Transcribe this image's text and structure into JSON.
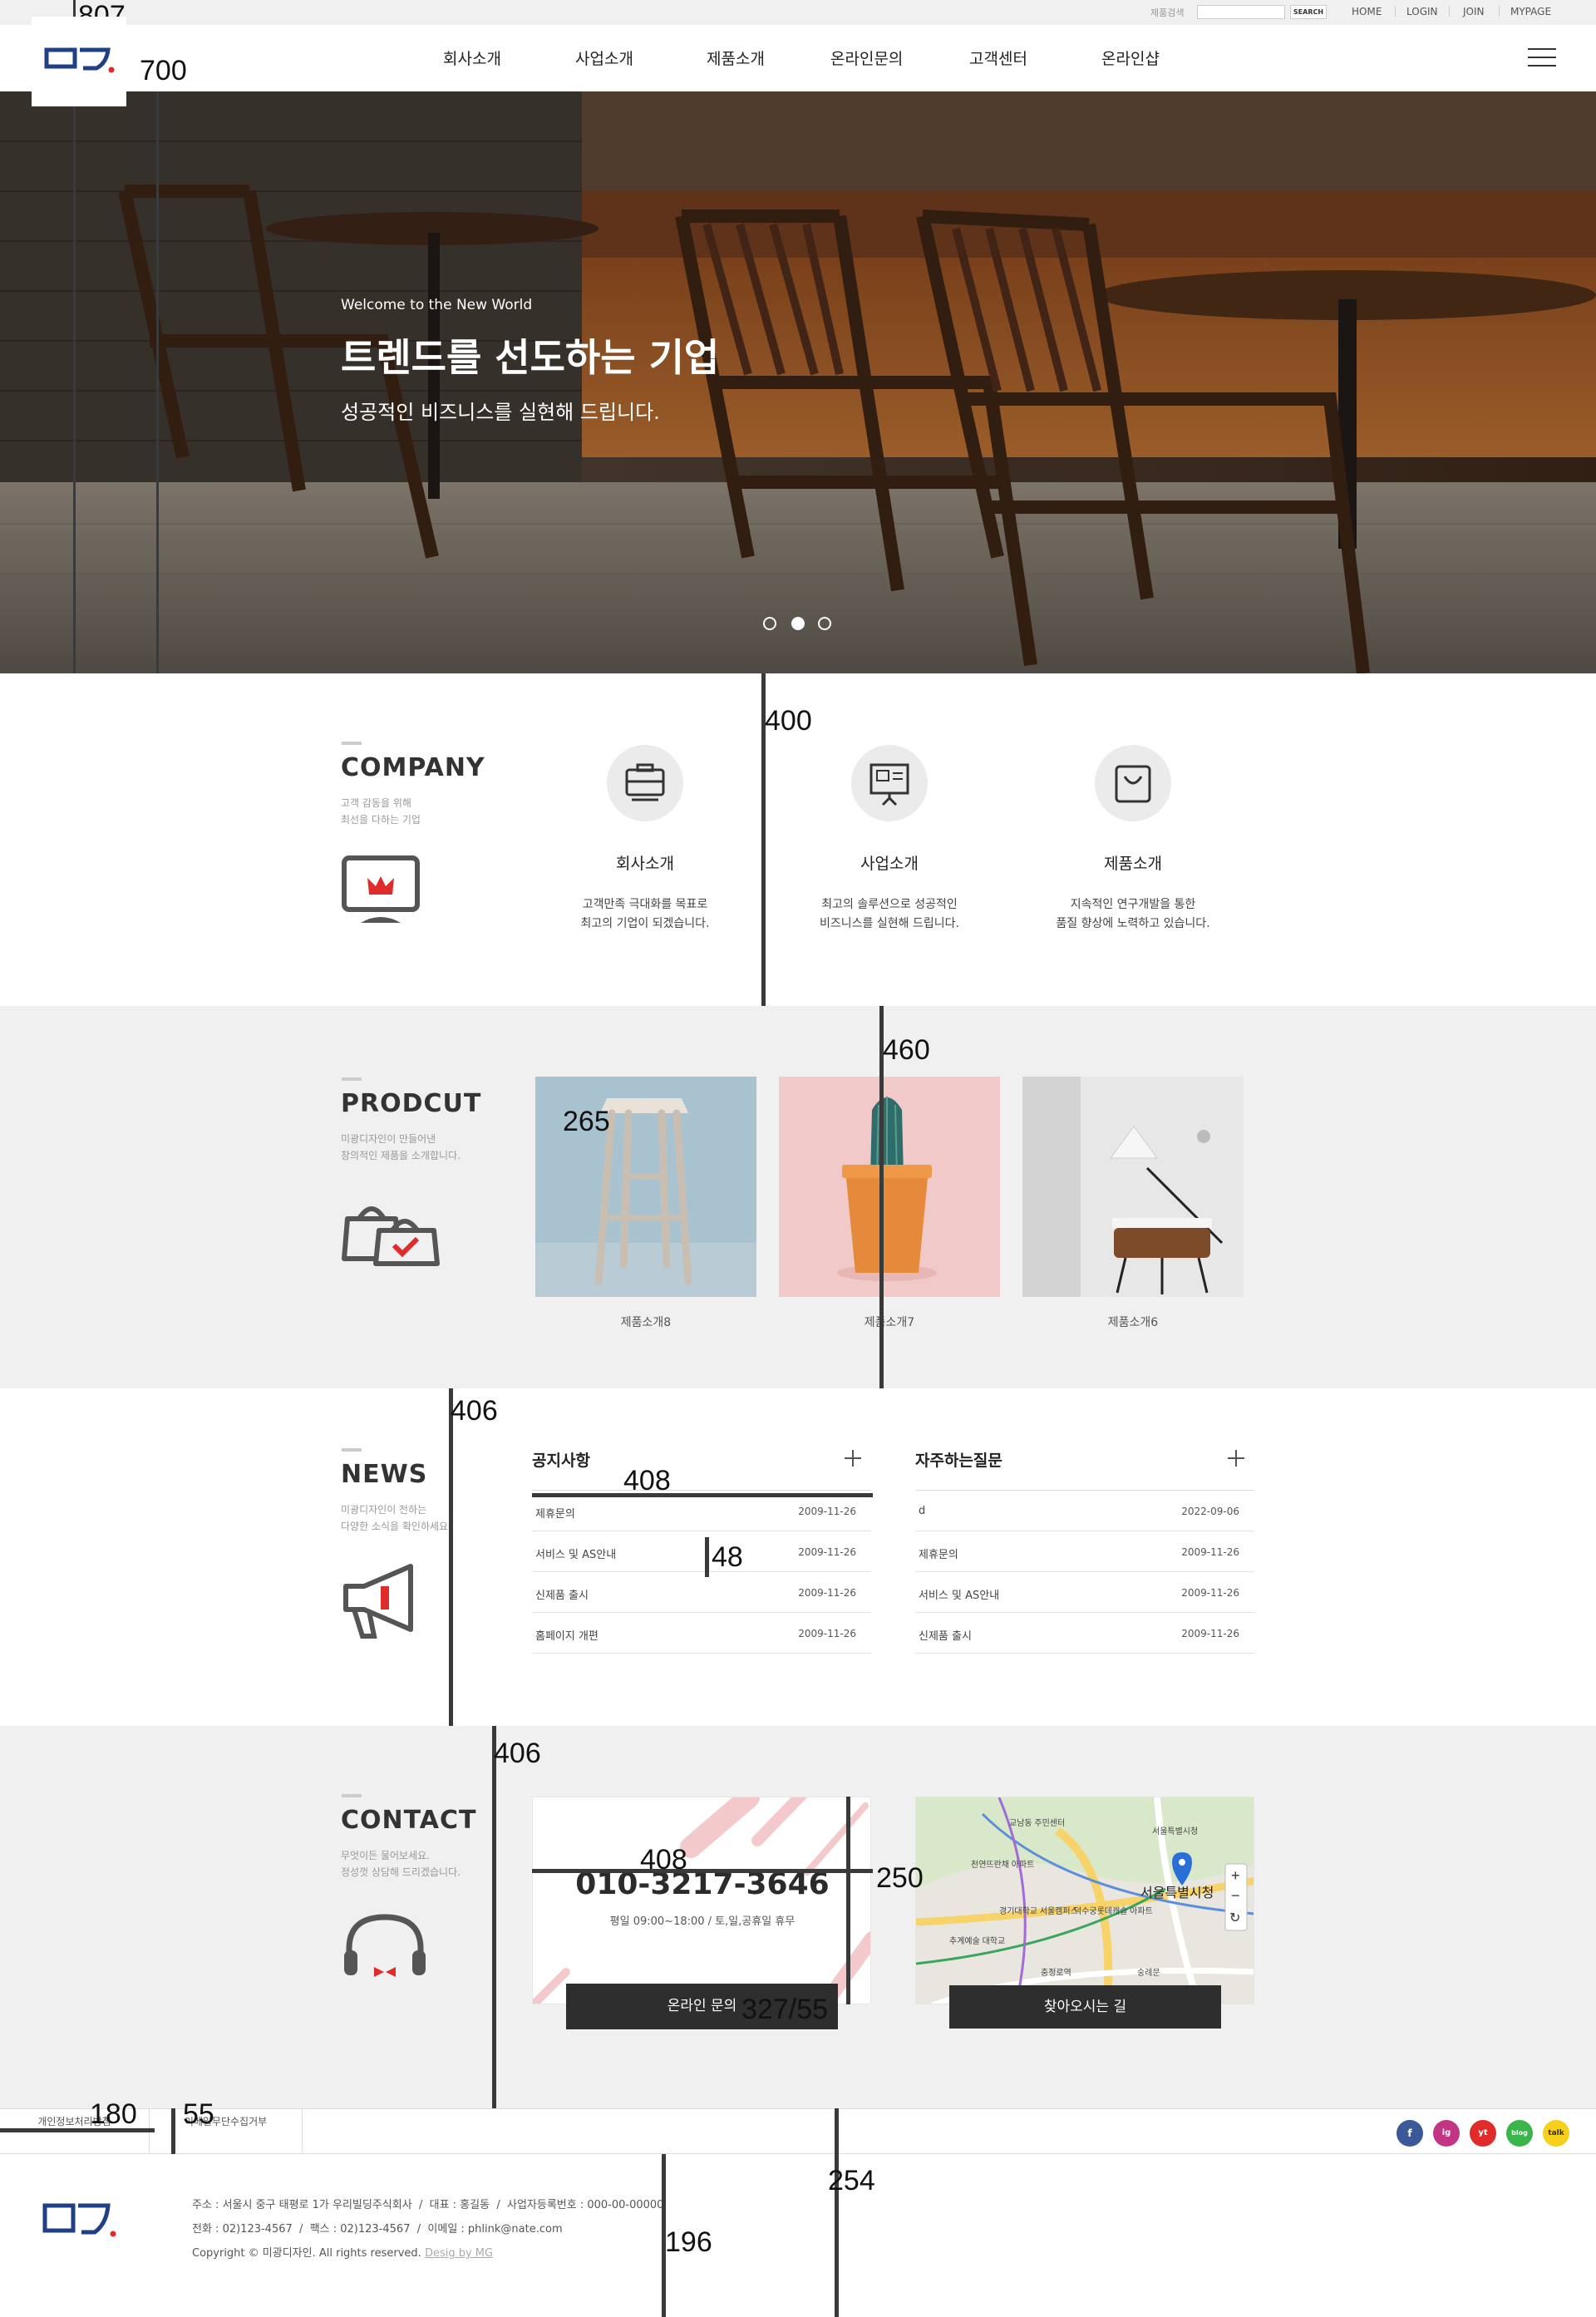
{
  "topbar": {
    "search_label": "제품검색",
    "search_placeholder": "",
    "search_button": "SEARCH",
    "links": [
      "HOME",
      "LOGIN",
      "JOIN",
      "MYPAGE"
    ]
  },
  "nav": [
    "회사소개",
    "사업소개",
    "제품소개",
    "온라인문의",
    "고객센터",
    "온라인샵"
  ],
  "hero": {
    "small": "Welcome to the New World",
    "title": "트렌드를 선도하는 기업",
    "subtitle": "성공적인 비즈니스를 실현해 드립니다."
  },
  "company": {
    "title": "COMPANY",
    "desc": [
      "고객 감동을 위해",
      "최선을 다하는 기업"
    ],
    "services": [
      {
        "name": "회사소개",
        "text": [
          "고객만족 극대화를 목표로",
          "최고의 기업이 되겠습니다."
        ]
      },
      {
        "name": "사업소개",
        "text": [
          "최고의 솔루션으로 성공적인",
          "비즈니스를 실현해 드립니다."
        ]
      },
      {
        "name": "제품소개",
        "text": [
          "지속적인 연구개발을 통한",
          "품질 향상에 노력하고 있습니다."
        ]
      }
    ]
  },
  "product": {
    "title": "PRODCUT",
    "desc": [
      "미광디자인이 만들어낸",
      "창의적인 제품을 소개합니다."
    ],
    "items": [
      "제품소개8",
      "제품소개7",
      "제품소개6"
    ]
  },
  "news": {
    "title": "NEWS",
    "desc": [
      "미광디자인이 전하는",
      "다양한 소식을 확인하세요."
    ],
    "notice": {
      "title": "공지사항",
      "rows": [
        {
          "t": "제휴문의",
          "d": "2009-11-26"
        },
        {
          "t": "서비스 및 AS안내",
          "d": "2009-11-26"
        },
        {
          "t": "신제품 출시",
          "d": "2009-11-26"
        },
        {
          "t": "홈페이지 개편",
          "d": "2009-11-26"
        }
      ]
    },
    "faq": {
      "title": "자주하는질문",
      "rows": [
        {
          "t": "d",
          "d": "2022-09-06"
        },
        {
          "t": "제휴문의",
          "d": "2009-11-26"
        },
        {
          "t": "서비스 및 AS안내",
          "d": "2009-11-26"
        },
        {
          "t": "신제품 출시",
          "d": "2009-11-26"
        }
      ]
    }
  },
  "contact": {
    "title": "CONTACT",
    "desc": [
      "무엇이든 물어보세요.",
      "정성껏 상담해 드리겠습니다."
    ],
    "phone": "010-3217-3646",
    "hours": "평일 09:00~18:00 / 토,일,공휴일 휴무",
    "inquiry_button": "온라인 문의",
    "map_button": "찾아오시는 길",
    "map_labels": [
      "교남동 주민센터",
      "천연뜨란채 아파트",
      "경기대학교 서울캠퍼스",
      "덕수궁롯데캐슬 아파트",
      "서울특별시청",
      "서울특별시청",
      "추계예술 대학교",
      "충정로역",
      "숭례문"
    ]
  },
  "footer": {
    "links": [
      "개인정보처리방침",
      "이메일무단수집거부"
    ],
    "sns": [
      "f",
      "ig",
      "yt",
      "blog",
      "talk"
    ],
    "address": "주소 : 서울시 중구 태평로 1가 우리빌딩주식회사",
    "ceo": "대표 : 홍길동",
    "bizno": "사업자등록번호 : 000-00-00000",
    "tel": "전화 : 02)123-4567",
    "fax": "팩스 : 02)123-4567",
    "email": "이메일 : phlink@nate.com",
    "copyright": "Copyright © 미광디자인. All rights reserved.",
    "design": "Desig by MG"
  },
  "measure_labels": [
    "807",
    "700",
    "400",
    "460",
    "265",
    "406",
    "408",
    "48",
    "406",
    "408",
    "250",
    "327",
    "55",
    "180",
    "55",
    "254",
    "196"
  ],
  "colors": {
    "brand_blue": "#1f3f86",
    "brand_red": "#e02b2b",
    "dark_button": "#2e2e2e",
    "gray_band": "#f0f0f0"
  }
}
